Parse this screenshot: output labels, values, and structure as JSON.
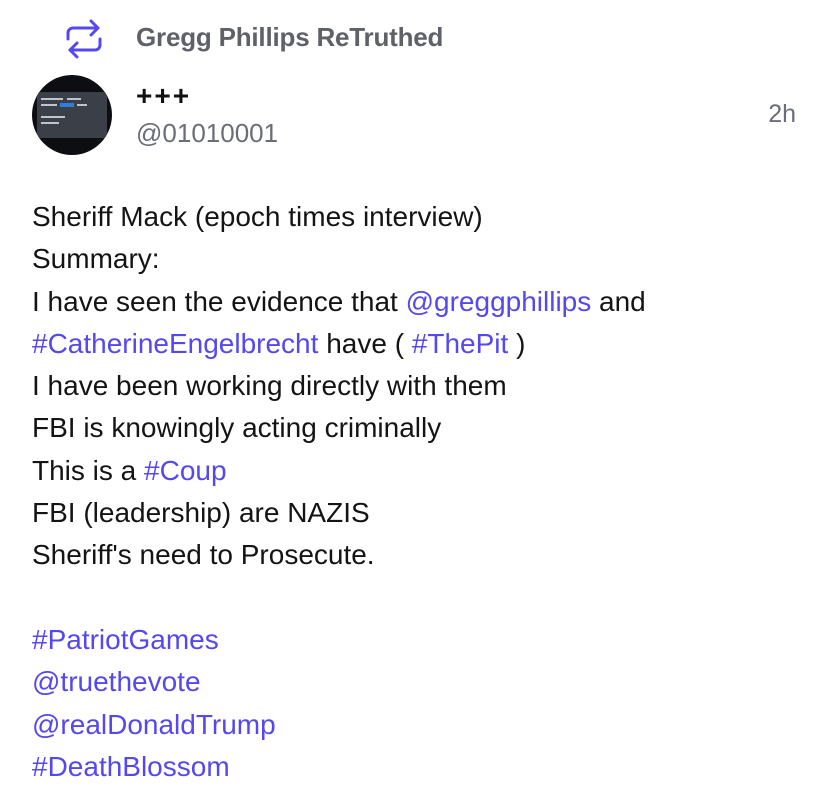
{
  "header": {
    "retruth_icon": "retruth-arrows-icon",
    "retruth_label": "Gregg Phillips ReTruthed",
    "accent_color": "#5448ee"
  },
  "author": {
    "avatar_icon": "avatar",
    "display_name": "+++",
    "handle": "@01010001",
    "time": "2h"
  },
  "post": {
    "line1": "Sheriff Mack (epoch times interview)",
    "line2": "Summary:",
    "line3_a": "I have seen the evidence that ",
    "line3_link": "@greggphillips",
    "line3_b": " and",
    "line4_link1": "#CatherineEngelbrecht",
    "line4_a": " have ( ",
    "line4_link2": "#ThePit",
    "line4_b": " )",
    "line5": "I have been working directly with them",
    "line6": "FBI is knowingly acting criminally",
    "line7_a": "This is a ",
    "line7_link": "#Coup",
    "line8": "FBI (leadership) are NAZIS",
    "line9": "Sheriff's need to Prosecute.",
    "tags": [
      "#PatriotGames",
      "@truethevote",
      "@realDonaldTrump",
      "#DeathBlossom"
    ]
  }
}
